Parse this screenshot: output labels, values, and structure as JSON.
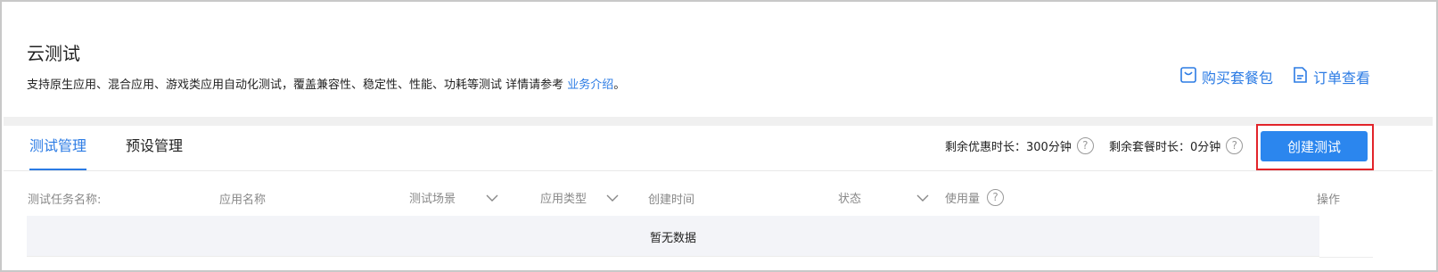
{
  "header": {
    "title": "云测试",
    "description": "支持原生应用、混合应用、游戏类应用自动化测试，覆盖兼容性、稳定性、性能、功耗等测试  详情请参考",
    "link_label": "业务介绍",
    "link_suffix": "。",
    "actions": [
      {
        "label": "购买套餐包",
        "icon": "bag-icon"
      },
      {
        "label": "订单查看",
        "icon": "order-icon"
      }
    ]
  },
  "tabs": [
    {
      "label": "测试管理",
      "active": true
    },
    {
      "label": "预设管理",
      "active": false
    }
  ],
  "quota": {
    "discount_label": "剩余优惠时长：300分钟",
    "package_label": "剩余套餐时长：0分钟"
  },
  "create_button": "创建测试",
  "table": {
    "columns": [
      "测试任务名称:",
      "应用名称",
      "测试场景",
      "应用类型",
      "创建时间",
      "状态",
      "使用量",
      "操作"
    ],
    "empty_text": "暂无数据"
  },
  "colors": {
    "accent": "#2b7be4",
    "button": "#2b86ee",
    "highlight": "#e2242a"
  }
}
